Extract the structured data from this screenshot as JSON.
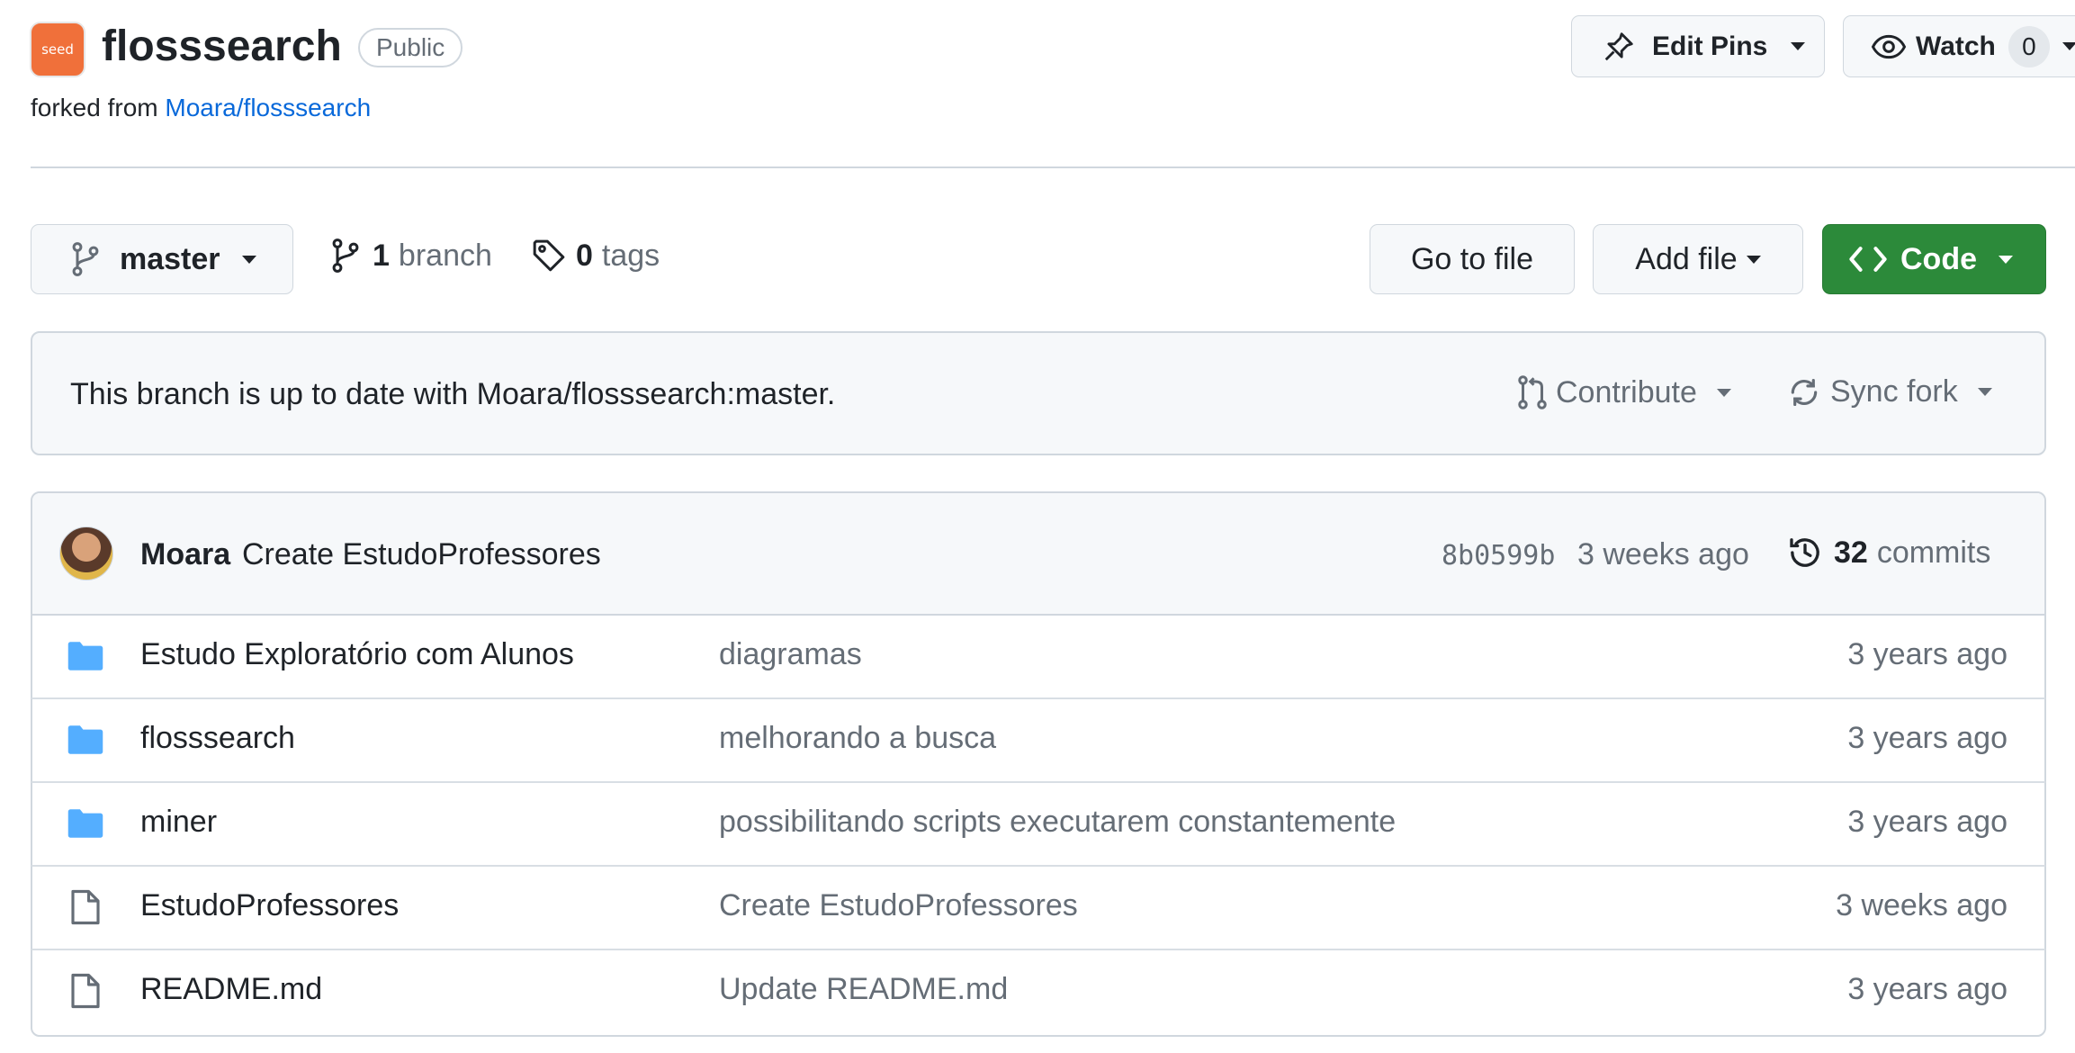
{
  "repo": {
    "logo_text": "seed",
    "name": "flosssearch",
    "visibility": "Public",
    "forked_prefix": "forked from",
    "forked_source": "Moara/flosssearch"
  },
  "header_actions": {
    "edit_pins": "Edit Pins",
    "watch": "Watch",
    "watch_count": "0"
  },
  "toolbar": {
    "branch": "master",
    "branch_count": "1",
    "branch_label": "branch",
    "tag_count": "0",
    "tag_label": "tags",
    "go_to_file": "Go to file",
    "add_file": "Add file",
    "code": "Code"
  },
  "fork_status": {
    "message": "This branch is up to date with Moara/flosssearch:master.",
    "contribute": "Contribute",
    "sync_fork": "Sync fork"
  },
  "latest_commit": {
    "author": "Moara",
    "message": "Create EstudoProfessores",
    "sha": "8b0599b",
    "time": "3 weeks ago",
    "commit_count": "32",
    "commits_label": "commits"
  },
  "files": [
    {
      "type": "folder",
      "name": "Estudo Exploratório com Alunos",
      "message": "diagramas",
      "age": "3 years ago"
    },
    {
      "type": "folder",
      "name": "flosssearch",
      "message": "melhorando a busca",
      "age": "3 years ago"
    },
    {
      "type": "folder",
      "name": "miner",
      "message": "possibilitando scripts executarem constantemente",
      "age": "3 years ago"
    },
    {
      "type": "file",
      "name": "EstudoProfessores",
      "message": "Create EstudoProfessores",
      "age": "3 weeks ago"
    },
    {
      "type": "file",
      "name": "README.md",
      "message": "Update README.md",
      "age": "3 years ago"
    }
  ],
  "colors": {
    "link": "#0969da",
    "code_button": "#2c8a3a",
    "folder_icon": "#54aeff",
    "logo_bg": "#f0703a"
  }
}
